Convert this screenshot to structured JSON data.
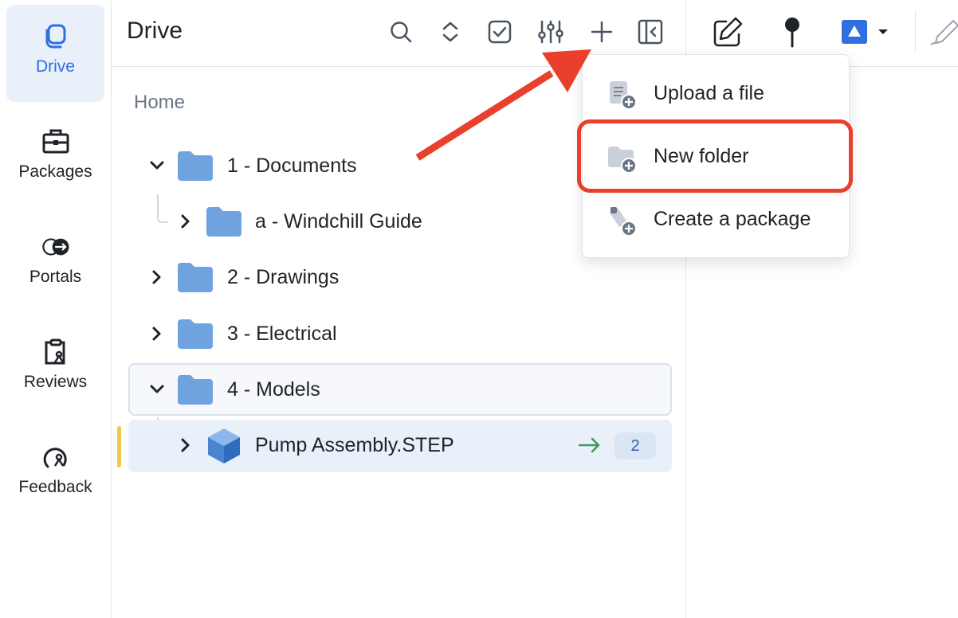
{
  "rail": {
    "items": [
      {
        "label": "Drive",
        "icon": "drive-icon",
        "active": true
      },
      {
        "label": "Packages",
        "icon": "briefcase-icon",
        "active": false
      },
      {
        "label": "Portals",
        "icon": "portal-icon",
        "active": false
      },
      {
        "label": "Reviews",
        "icon": "clipboard-icon",
        "active": false
      },
      {
        "label": "Feedback",
        "icon": "feedback-icon",
        "active": false
      }
    ]
  },
  "panel": {
    "title": "Drive",
    "toolbar": [
      "search-icon",
      "expand-collapse-icon",
      "checkbox-icon",
      "filter-sliders-icon",
      "plus-icon",
      "sidebar-collapse-icon"
    ]
  },
  "breadcrumb": "Home",
  "tree": [
    {
      "label": "1 - Documents",
      "expanded": true,
      "level": 0,
      "type": "folder"
    },
    {
      "label": "a - Windchill Guide",
      "expanded": false,
      "level": 1,
      "type": "folder"
    },
    {
      "label": "2 - Drawings",
      "expanded": false,
      "level": 0,
      "type": "folder"
    },
    {
      "label": "3 - Electrical",
      "expanded": false,
      "level": 0,
      "type": "folder"
    },
    {
      "label": "4 - Models",
      "expanded": true,
      "level": 0,
      "type": "folder"
    },
    {
      "label": "Pump Assembly.STEP",
      "expanded": false,
      "level": 1,
      "type": "model",
      "badge": "2"
    }
  ],
  "menu": {
    "items": [
      {
        "label": "Upload a file",
        "icon": "upload-file-icon"
      },
      {
        "label": "New folder",
        "icon": "new-folder-icon"
      },
      {
        "label": "Create a package",
        "icon": "create-package-icon"
      }
    ]
  },
  "colors": {
    "accent": "#2f6fe0",
    "folder": "#6fa3e0",
    "highlight": "#e8402c",
    "arrow": "#3a9b5a"
  }
}
